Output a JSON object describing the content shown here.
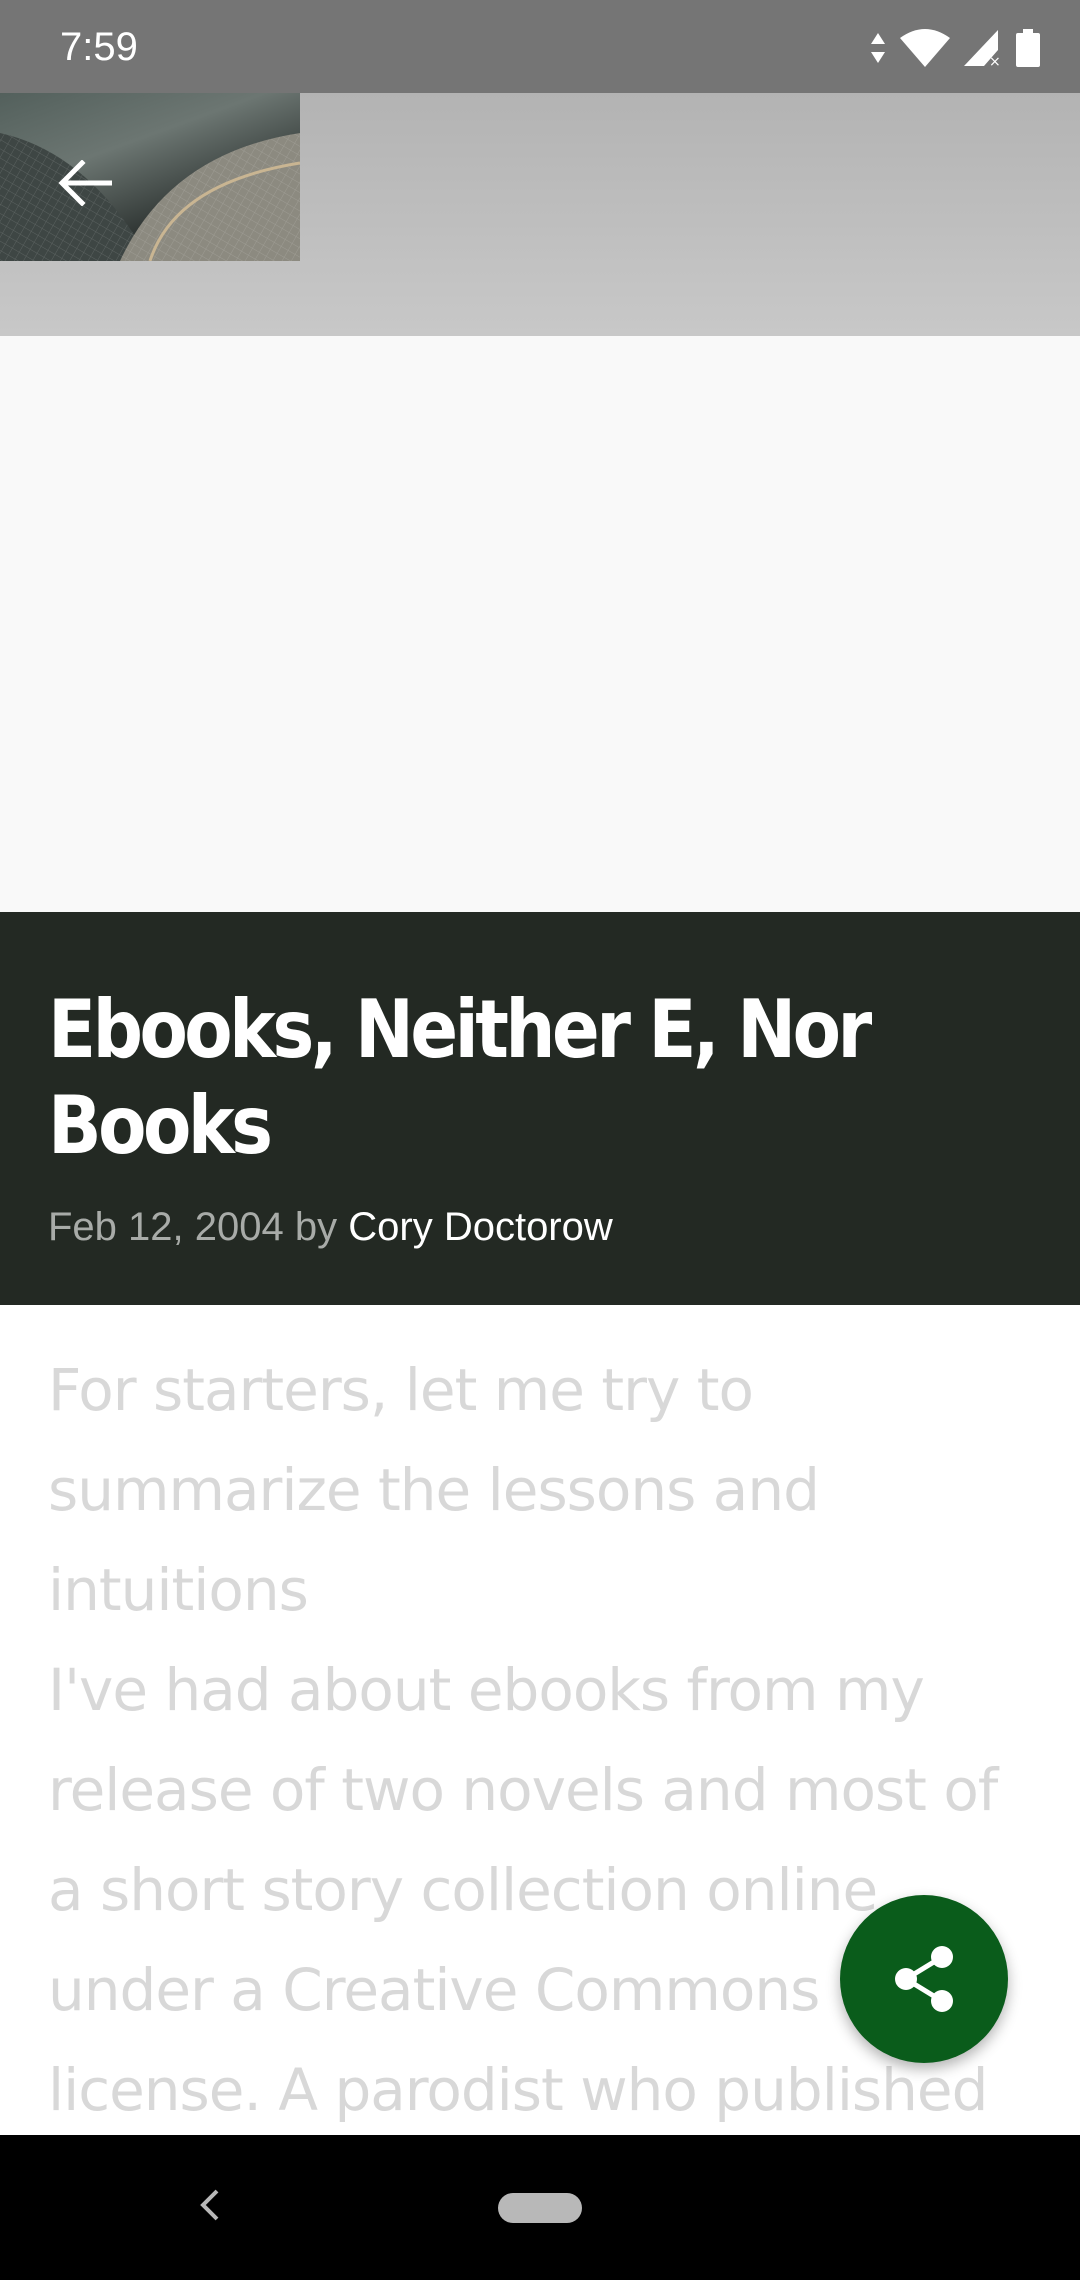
{
  "status_bar": {
    "time": "7:59",
    "icons": [
      "data-arrows-icon",
      "wifi-icon",
      "cell-signal-icon",
      "battery-icon"
    ]
  },
  "header": {
    "back_icon": "arrow-left-icon"
  },
  "post": {
    "title": "Ebooks, Neither E, Nor Books",
    "date": "Feb 12, 2004",
    "by": "by",
    "author": "Cory Doctorow"
  },
  "article": {
    "paragraph": "For starters, let me try to summarize the lessons and intuitions",
    "paragraph2": "I've had about ebooks from my release of two novels and most of a short story collection online under a Creative Commons license. A parodist who published a list of"
  },
  "fab": {
    "icon": "share-icon",
    "color": "#0a5c1b"
  },
  "colors": {
    "title_bar": "#232923",
    "accent": "#0a5c1b"
  },
  "nav_bar": {
    "icons": [
      "chevron-left-icon",
      "home-pill-icon"
    ]
  }
}
